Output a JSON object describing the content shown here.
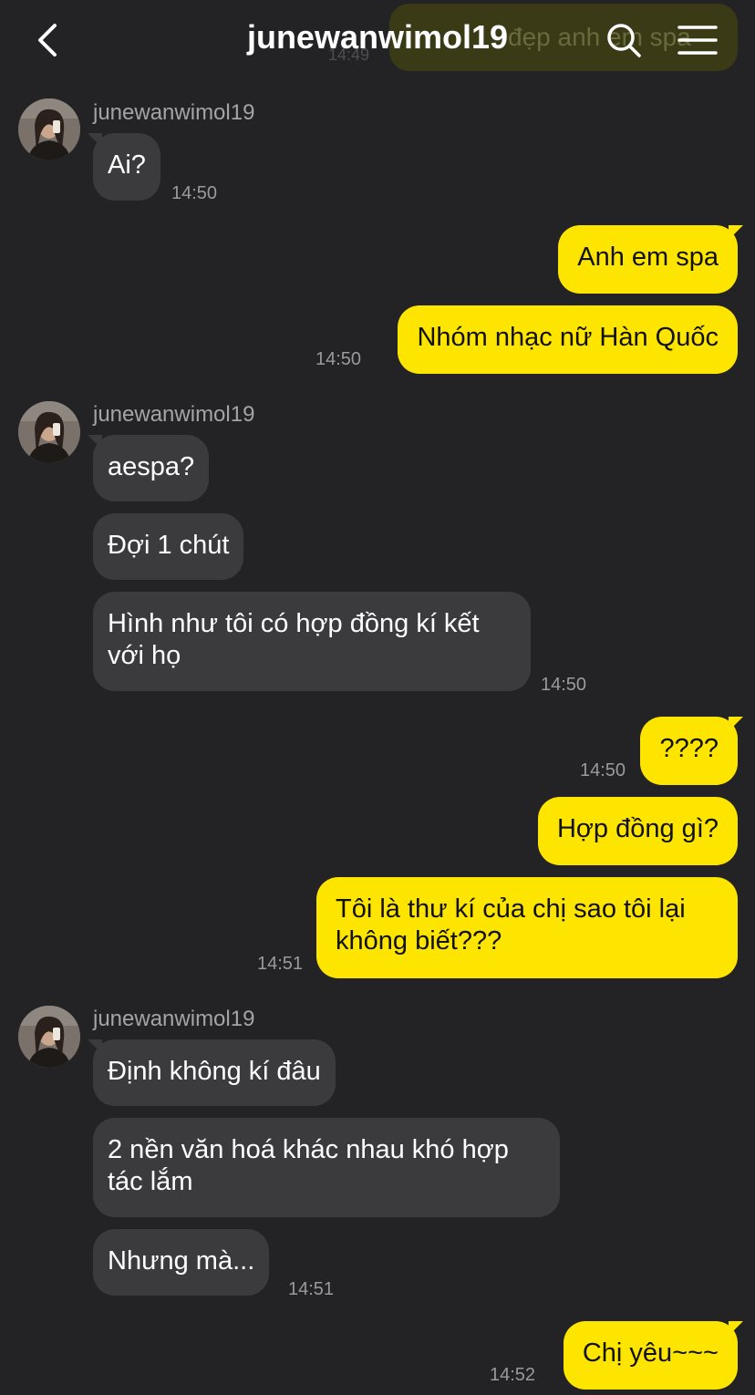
{
  "header": {
    "title": "junewanwimol19",
    "ghost_preview": "đẹp anh em spa",
    "ghost_time": "14:49"
  },
  "contact": {
    "name": "junewanwimol19"
  },
  "messages": {
    "m1": "Ai?",
    "t1": "14:50",
    "m2": "Anh em spa",
    "m3": "Nhóm nhạc nữ Hàn Quốc",
    "t2": "14:50",
    "m4": "aespa?",
    "m5": "Đợi 1 chút",
    "m6_line1": "Hình như tôi có hợp đồng kí kết",
    "m6_line2": "với họ",
    "t3": "14:50",
    "m7": "????",
    "t4": "14:50",
    "m8": "Hợp đồng gì?",
    "m9_line1": "Tôi là thư kí của chị sao tôi lại",
    "m9_line2": "không biết???",
    "t5": "14:51",
    "m10": "Định không kí đâu",
    "m11_line1": "2 nền văn hoá khác nhau khó hợp",
    "m11_line2": "tác lắm",
    "m12": "Nhưng mà...",
    "t6": "14:51",
    "m13": "Chị yêu~~~",
    "t7": "14:52"
  },
  "colors": {
    "background": "#232325",
    "incoming_bubble": "#3b3b3d",
    "outgoing_bubble": "#fde500"
  },
  "icons": [
    "back-arrow-icon",
    "search-icon",
    "menu-icon",
    "avatar-image"
  ]
}
